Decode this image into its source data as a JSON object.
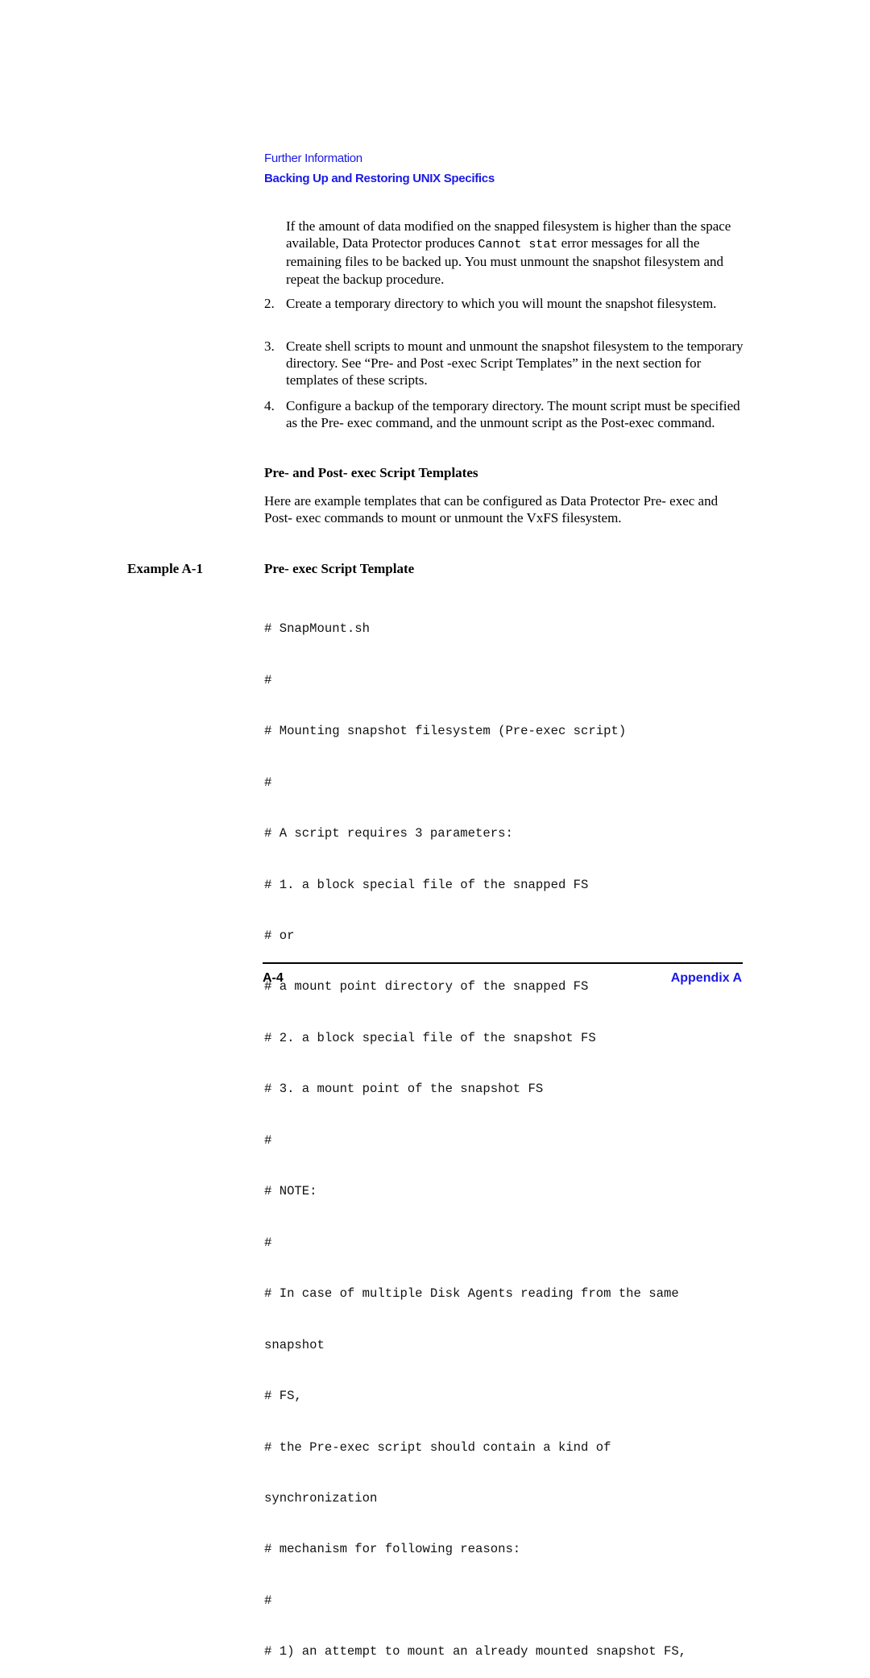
{
  "header": {
    "chapter": "Further Information",
    "section": "Backing Up and Restoring UNIX Specifics"
  },
  "intro_paragraph": {
    "before_code": "If the amount of data modified on the snapped filesystem is higher than the space available, Data Protector produces ",
    "code": "Cannot stat",
    "after_code": " error messages for all the remaining files to be backed up. You must unmount the snapshot filesystem and repeat the backup procedure."
  },
  "steps": [
    {
      "number": "2.",
      "text": "Create a temporary directory to which you will mount the snapshot filesystem."
    },
    {
      "number": "3.",
      "text": "Create shell scripts to mount and unmount the snapshot filesystem to the temporary directory. See “Pre- and Post -exec Script Templates” in the next section for templates of these scripts."
    },
    {
      "number": "4.",
      "text": "Configure a backup of the temporary directory. The mount script must be specified as the Pre- exec command, and the unmount script as the Post-exec command."
    }
  ],
  "templates_section": {
    "heading": "Pre- and Post- exec Script Templates",
    "paragraph": "Here are example templates that can be configured as Data Protector Pre- exec and Post- exec commands to mount or unmount the VxFS filesystem."
  },
  "example": {
    "label": "Example A-1",
    "title": "Pre- exec Script Template",
    "code_lines": [
      "# SnapMount.sh",
      "#",
      "# Mounting snapshot filesystem (Pre-exec script)",
      "#",
      "# A script requires 3 parameters:",
      "# 1. a block special file of the snapped FS",
      "# or",
      "# a mount point directory of the snapped FS",
      "# 2. a block special file of the snapshot FS",
      "# 3. a mount point of the snapshot FS",
      "#",
      "# NOTE:",
      "#",
      "# In case of multiple Disk Agents reading from the same",
      "snapshot",
      "# FS,",
      "# the Pre-exec script should contain a kind of",
      "synchronization",
      "# mechanism for following reasons:",
      "#",
      "# 1) an attempt to mount an already mounted snapshot FS,"
    ]
  },
  "footer": {
    "page_number": "A-4",
    "appendix": "Appendix A"
  },
  "colors": {
    "link_blue": "#1a1ae6",
    "text": "#000000"
  }
}
